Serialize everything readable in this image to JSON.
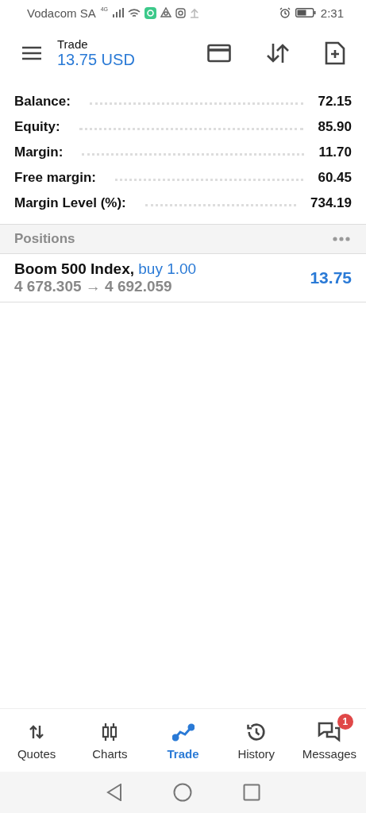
{
  "status_bar": {
    "carrier": "Vodacom SA",
    "network": "4G",
    "time": "2:31"
  },
  "header": {
    "title": "Trade",
    "subtitle": "13.75 USD"
  },
  "account": [
    {
      "label": "Balance:",
      "value": "72.15"
    },
    {
      "label": "Equity:",
      "value": "85.90"
    },
    {
      "label": "Margin:",
      "value": "11.70"
    },
    {
      "label": "Free margin:",
      "value": "60.45"
    },
    {
      "label": "Margin Level (%):",
      "value": "734.19"
    }
  ],
  "positions": {
    "title": "Positions",
    "items": [
      {
        "symbol": "Boom 500 Index,",
        "order": "buy 1.00",
        "prices": "4 678.305 → 4 692.059",
        "profit": "13.75"
      }
    ]
  },
  "bottom_nav": [
    {
      "kind": "quotes",
      "label": "Quotes",
      "selected": false
    },
    {
      "kind": "charts",
      "label": "Charts",
      "selected": false
    },
    {
      "kind": "trade",
      "label": "Trade",
      "selected": true
    },
    {
      "kind": "history",
      "label": "History",
      "selected": false
    },
    {
      "kind": "messages",
      "label": "Messages",
      "selected": false,
      "badge": "1"
    }
  ]
}
